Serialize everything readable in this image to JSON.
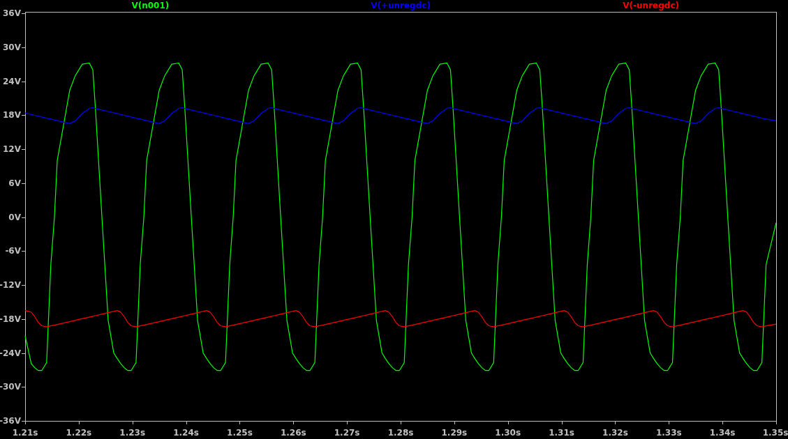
{
  "plot": {
    "chart_data": {
      "type": "line",
      "xlim": [
        1.21,
        1.35
      ],
      "ylim": [
        -36,
        36
      ],
      "xticks": [
        {
          "value": 1.21,
          "label": "1.21s"
        },
        {
          "value": 1.22,
          "label": "1.22s"
        },
        {
          "value": 1.23,
          "label": "1.23s"
        },
        {
          "value": 1.24,
          "label": "1.24s"
        },
        {
          "value": 1.25,
          "label": "1.25s"
        },
        {
          "value": 1.26,
          "label": "1.26s"
        },
        {
          "value": 1.27,
          "label": "1.27s"
        },
        {
          "value": 1.28,
          "label": "1.28s"
        },
        {
          "value": 1.29,
          "label": "1.29s"
        },
        {
          "value": 1.3,
          "label": "1.30s"
        },
        {
          "value": 1.31,
          "label": "1.31s"
        },
        {
          "value": 1.32,
          "label": "1.32s"
        },
        {
          "value": 1.33,
          "label": "1.33s"
        },
        {
          "value": 1.34,
          "label": "1.34s"
        },
        {
          "value": 1.35,
          "label": "1.35s"
        }
      ],
      "yticks": [
        {
          "value": 36,
          "label": "36V"
        },
        {
          "value": 30,
          "label": "30V"
        },
        {
          "value": 24,
          "label": "24V"
        },
        {
          "value": 18,
          "label": "18V"
        },
        {
          "value": 12,
          "label": "12V"
        },
        {
          "value": 6,
          "label": "6V"
        },
        {
          "value": 0,
          "label": "0V"
        },
        {
          "value": -6,
          "label": "-6V"
        },
        {
          "value": -12,
          "label": "-12V"
        },
        {
          "value": -18,
          "label": "-18V"
        },
        {
          "value": -24,
          "label": "-24V"
        },
        {
          "value": -30,
          "label": "-30V"
        },
        {
          "value": -36,
          "label": "-36V"
        }
      ],
      "x": [
        1.21,
        1.21115,
        1.2118,
        1.21245,
        1.2131,
        1.21401,
        1.21479,
        1.21546,
        1.21598,
        1.21832,
        1.21936,
        1.22066,
        1.22197,
        1.22262,
        1.22314,
        1.22431,
        1.22548,
        1.22652,
        1.22717,
        1.22782,
        1.22847,
        1.22912,
        1.22977,
        1.23068,
        1.23146,
        1.23213,
        1.23265,
        1.23499,
        1.23603,
        1.23733,
        1.23864,
        1.23929,
        1.23981,
        1.24098,
        1.24215,
        1.24319,
        1.24384,
        1.24449,
        1.24514,
        1.24579,
        1.24644,
        1.24735,
        1.24813,
        1.24879,
        1.24931,
        1.25165,
        1.25269,
        1.25399,
        1.2553,
        1.25595,
        1.25647,
        1.25764,
        1.25881,
        1.25985,
        1.2605,
        1.26115,
        1.2618,
        1.26245,
        1.2631,
        1.26401,
        1.26479,
        1.26546,
        1.26598,
        1.26832,
        1.26936,
        1.27066,
        1.27197,
        1.27262,
        1.27314,
        1.27431,
        1.27548,
        1.27652,
        1.27717,
        1.27782,
        1.27847,
        1.27912,
        1.27977,
        1.28068,
        1.28146,
        1.28213,
        1.28265,
        1.28499,
        1.28603,
        1.28733,
        1.28864,
        1.28929,
        1.28981,
        1.29098,
        1.29215,
        1.29319,
        1.29384,
        1.29449,
        1.29514,
        1.29579,
        1.29644,
        1.29735,
        1.29813,
        1.29879,
        1.29931,
        1.30165,
        1.30269,
        1.30399,
        1.3053,
        1.30595,
        1.30647,
        1.30764,
        1.30881,
        1.30985,
        1.3105,
        1.31115,
        1.3118,
        1.31245,
        1.3131,
        1.31401,
        1.31479,
        1.31546,
        1.31598,
        1.31832,
        1.31936,
        1.32066,
        1.32197,
        1.32262,
        1.32314,
        1.32431,
        1.32548,
        1.32652,
        1.32717,
        1.32782,
        1.32847,
        1.32912,
        1.32977,
        1.33068,
        1.33146,
        1.33213,
        1.33265,
        1.33499,
        1.33603,
        1.33733,
        1.33864,
        1.33929,
        1.33981,
        1.34098,
        1.34215,
        1.34319,
        1.34384,
        1.34449,
        1.34514,
        1.34579,
        1.34644,
        1.34735,
        1.34813,
        1.35
      ],
      "series": [
        {
          "name": "V(n001)",
          "color": "#00ff00",
          "values": [
            -21,
            -25.9,
            -26.6,
            -27.1,
            -27.1,
            -25.7,
            -8.4,
            0,
            10,
            22.4,
            25,
            27,
            27.2,
            26,
            18.6,
            0,
            -18.3,
            -24,
            -25,
            -25.9,
            -26.6,
            -27.1,
            -27.1,
            -25.7,
            -8.4,
            0,
            10,
            22.4,
            25,
            27,
            27.2,
            26,
            18.6,
            0,
            -18.3,
            -24,
            -25,
            -25.9,
            -26.6,
            -27.1,
            -27.1,
            -25.7,
            -8.4,
            0,
            10,
            22.4,
            25,
            27,
            27.2,
            26,
            18.6,
            0,
            -18.3,
            -24,
            -25,
            -25.9,
            -26.6,
            -27.1,
            -27.1,
            -25.7,
            -8.4,
            0,
            10,
            22.4,
            25,
            27,
            27.2,
            26,
            18.6,
            0,
            -18.3,
            -24,
            -25,
            -25.9,
            -26.6,
            -27.1,
            -27.1,
            -25.7,
            -8.4,
            0,
            10,
            22.4,
            25,
            27,
            27.2,
            26,
            18.6,
            0,
            -18.3,
            -24,
            -25,
            -25.9,
            -26.6,
            -27.1,
            -27.1,
            -25.7,
            -8.4,
            0,
            10,
            22.4,
            25,
            27,
            27.2,
            26,
            18.6,
            0,
            -18.3,
            -24,
            -25,
            -25.9,
            -26.6,
            -27.1,
            -27.1,
            -25.7,
            -8.4,
            0,
            10,
            22.4,
            25,
            27,
            27.2,
            26,
            18.6,
            0,
            -18.3,
            -24,
            -25,
            -25.9,
            -26.6,
            -27.1,
            -27.1,
            -25.7,
            -8.4,
            0,
            10,
            22.4,
            25,
            27,
            27.2,
            26,
            18.6,
            0,
            -18.3,
            -24,
            -25,
            -25.9,
            -26.6,
            -27.1,
            -27.1,
            -25.7,
            -8.4,
            -1
          ]
        },
        {
          "name": "V(+unregdc)",
          "color": "#0000ff",
          "values": [
            18.4,
            18.12,
            17.97,
            17.82,
            17.68,
            17.47,
            17.3,
            17.15,
            17.03,
            16.5,
            17.0,
            18.3,
            19.2,
            19.3,
            19.18,
            18.92,
            18.65,
            18.41,
            18.27,
            18.12,
            17.97,
            17.82,
            17.68,
            17.47,
            17.3,
            17.15,
            17.03,
            16.5,
            17.0,
            18.3,
            19.2,
            19.3,
            19.18,
            18.92,
            18.65,
            18.41,
            18.27,
            18.12,
            17.97,
            17.82,
            17.68,
            17.47,
            17.3,
            17.15,
            17.03,
            16.5,
            17.0,
            18.3,
            19.2,
            19.3,
            19.18,
            18.92,
            18.65,
            18.41,
            18.27,
            18.12,
            17.97,
            17.82,
            17.68,
            17.47,
            17.3,
            17.15,
            17.03,
            16.5,
            17.0,
            18.3,
            19.2,
            19.3,
            19.18,
            18.92,
            18.65,
            18.41,
            18.27,
            18.12,
            17.97,
            17.82,
            17.68,
            17.47,
            17.3,
            17.15,
            17.03,
            16.5,
            17.0,
            18.3,
            19.2,
            19.3,
            19.18,
            18.92,
            18.65,
            18.41,
            18.27,
            18.12,
            17.97,
            17.82,
            17.68,
            17.47,
            17.3,
            17.15,
            17.03,
            16.5,
            17.0,
            18.3,
            19.2,
            19.3,
            19.18,
            18.92,
            18.65,
            18.41,
            18.27,
            18.12,
            17.97,
            17.82,
            17.68,
            17.47,
            17.3,
            17.15,
            17.03,
            16.5,
            17.0,
            18.3,
            19.2,
            19.3,
            19.18,
            18.92,
            18.65,
            18.41,
            18.27,
            18.12,
            17.97,
            17.82,
            17.68,
            17.47,
            17.3,
            17.15,
            17.03,
            16.5,
            17.0,
            18.3,
            19.2,
            19.3,
            19.18,
            18.92,
            18.65,
            18.41,
            18.27,
            18.12,
            17.97,
            17.82,
            17.68,
            17.47,
            17.3,
            17.0
          ]
        },
        {
          "name": "V(-unregdc)",
          "color": "#ff0000",
          "values": [
            -16.5,
            -16.8,
            -17.6,
            -18.6,
            -19.2,
            -19.4,
            -19.23,
            -19.1,
            -18.98,
            -18.47,
            -18.24,
            -17.95,
            -17.67,
            -17.52,
            -17.41,
            -17.15,
            -16.89,
            -16.66,
            -16.5,
            -16.8,
            -17.6,
            -18.6,
            -19.2,
            -19.4,
            -19.23,
            -19.1,
            -18.98,
            -18.47,
            -18.24,
            -17.95,
            -17.67,
            -17.52,
            -17.41,
            -17.15,
            -16.89,
            -16.66,
            -16.5,
            -16.8,
            -17.6,
            -18.6,
            -19.2,
            -19.4,
            -19.23,
            -19.1,
            -18.98,
            -18.47,
            -18.24,
            -17.95,
            -17.67,
            -17.52,
            -17.41,
            -17.15,
            -16.89,
            -16.66,
            -16.5,
            -16.8,
            -17.6,
            -18.6,
            -19.2,
            -19.4,
            -19.23,
            -19.1,
            -18.98,
            -18.47,
            -18.24,
            -17.95,
            -17.67,
            -17.52,
            -17.41,
            -17.15,
            -16.89,
            -16.66,
            -16.5,
            -16.8,
            -17.6,
            -18.6,
            -19.2,
            -19.4,
            -19.23,
            -19.1,
            -18.98,
            -18.47,
            -18.24,
            -17.95,
            -17.67,
            -17.52,
            -17.41,
            -17.15,
            -16.89,
            -16.66,
            -16.5,
            -16.8,
            -17.6,
            -18.6,
            -19.2,
            -19.4,
            -19.23,
            -19.1,
            -18.98,
            -18.47,
            -18.24,
            -17.95,
            -17.67,
            -17.52,
            -17.41,
            -17.15,
            -16.89,
            -16.66,
            -16.5,
            -16.8,
            -17.6,
            -18.6,
            -19.2,
            -19.4,
            -19.23,
            -19.1,
            -18.98,
            -18.47,
            -18.24,
            -17.95,
            -17.67,
            -17.52,
            -17.41,
            -17.15,
            -16.89,
            -16.66,
            -16.5,
            -16.8,
            -17.6,
            -18.6,
            -19.2,
            -19.4,
            -19.23,
            -19.1,
            -18.98,
            -18.47,
            -18.24,
            -17.95,
            -17.67,
            -17.52,
            -17.41,
            -17.15,
            -16.89,
            -16.66,
            -16.5,
            -16.8,
            -17.6,
            -18.6,
            -19.2,
            -19.4,
            -19.23,
            -18.9
          ]
        }
      ]
    }
  }
}
